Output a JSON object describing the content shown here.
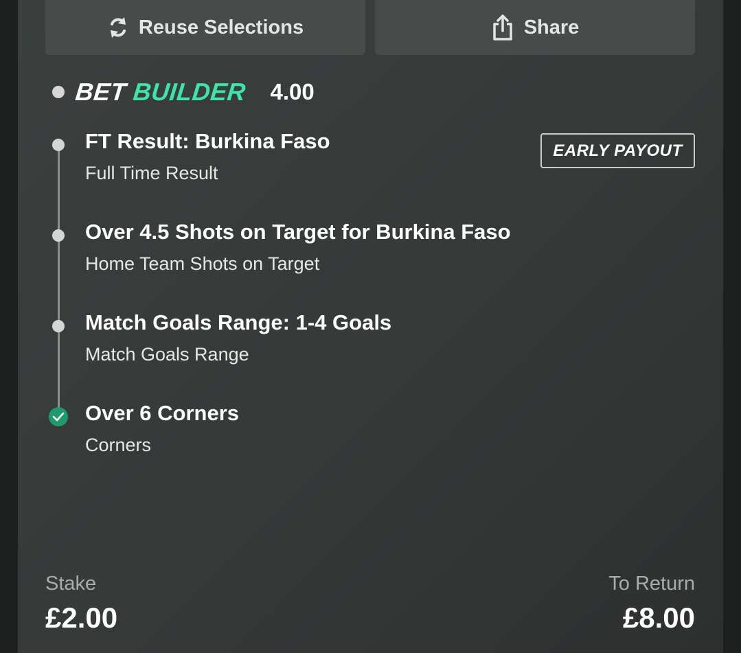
{
  "actions": {
    "reuse_label": "Reuse Selections",
    "share_label": "Share"
  },
  "bet": {
    "brand_part1": "BET",
    "brand_part2": "BUILDER",
    "odds": "4.00",
    "badge": "EARLY PAYOUT",
    "brand_color": "#3fe4a8",
    "selections": [
      {
        "title": "FT Result: Burkina Faso",
        "subtitle": "Full Time Result",
        "status": "pending"
      },
      {
        "title": "Over 4.5 Shots on Target for Burkina Faso",
        "subtitle": "Home Team Shots on Target",
        "status": "pending"
      },
      {
        "title": "Match Goals Range: 1-4 Goals",
        "subtitle": "Match Goals Range",
        "status": "pending"
      },
      {
        "title": "Over 6 Corners",
        "subtitle": "Corners",
        "status": "won"
      }
    ]
  },
  "footer": {
    "stake_label": "Stake",
    "stake_value": "£2.00",
    "return_label": "To Return",
    "return_value": "£8.00"
  },
  "icons": {
    "reuse": "refresh-icon",
    "share": "share-icon",
    "check": "check-icon"
  }
}
